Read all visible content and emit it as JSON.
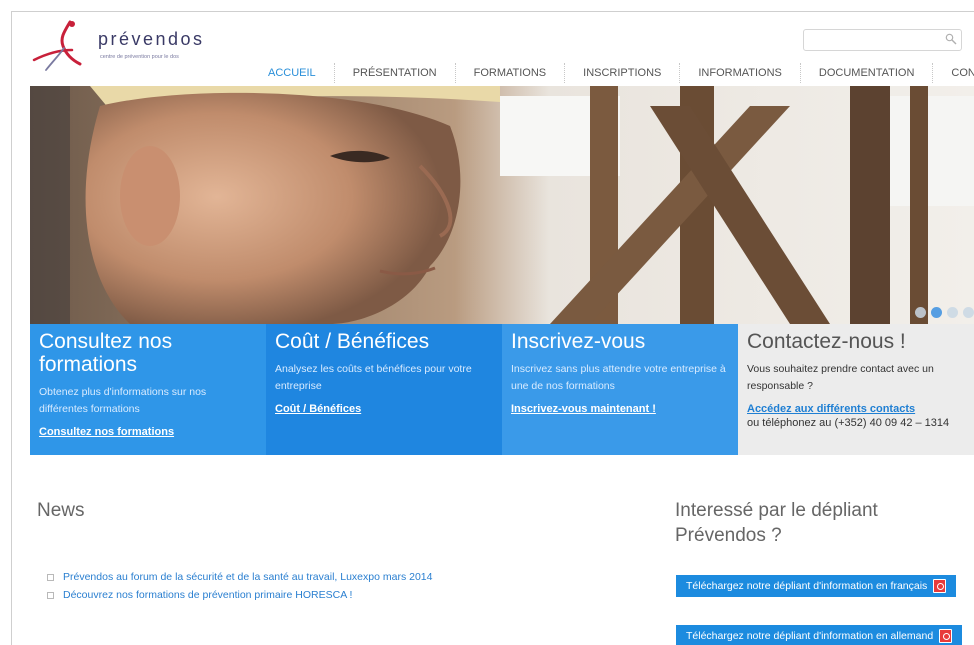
{
  "logo": {
    "name": "prévendos",
    "tagline": "centre de prévention pour le dos"
  },
  "search": {
    "placeholder": ""
  },
  "nav": [
    {
      "label": "ACCUEIL",
      "active": true
    },
    {
      "label": "PRÉSENTATION",
      "active": false
    },
    {
      "label": "FORMATIONS",
      "active": false
    },
    {
      "label": "INSCRIPTIONS",
      "active": false
    },
    {
      "label": "INFORMATIONS",
      "active": false
    },
    {
      "label": "DOCUMENTATION",
      "active": false
    },
    {
      "label": "CONTACT",
      "active": false
    }
  ],
  "hero": {
    "slides": 4,
    "active_slide": 2
  },
  "boxes": [
    {
      "title": "Consultez nos formations",
      "text": "Obtenez plus d'informations sur nos différentes formations",
      "link": "Consultez nos formations"
    },
    {
      "title": "Coût / Bénéfices",
      "text": "Analysez les coûts et bénéfices pour votre entreprise",
      "link": "Coût / Bénéfices"
    },
    {
      "title": "Inscrivez-vous",
      "text": "Inscrivez sans plus attendre votre entreprise à une de nos formations",
      "link": "Inscrivez-vous maintenant !"
    },
    {
      "title": "Contactez-nous !",
      "text": "Vous souhaitez prendre contact avec un responsable ?",
      "link": "Accédez aux différents contacts",
      "phone": "ou téléphonez au  (+352) 40 09 42 – 1314"
    }
  ],
  "news": {
    "title": "News",
    "items": [
      "Prévendos au forum de la sécurité et de la santé au travail, Luxexpo mars 2014",
      "Découvrez nos formations de prévention primaire HORESCA !"
    ]
  },
  "brochure": {
    "title": "Interessé par le dépliant Prévendos ?",
    "buttons": [
      "Téléchargez notre dépliant d'information en français",
      "Téléchargez notre dépliant d'information en allemand"
    ]
  },
  "colors": {
    "accent": "#2f96e8",
    "accent_dark": "#1f86e0",
    "contact_bg": "#ececec"
  }
}
